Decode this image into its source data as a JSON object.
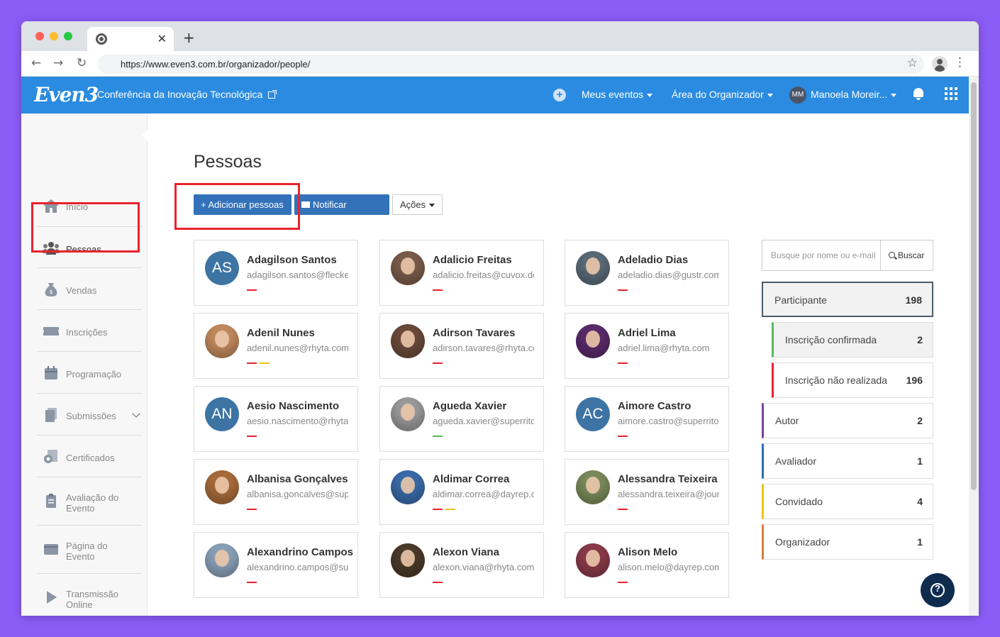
{
  "browser": {
    "url": "https://www.even3.com.br/organizador/people/"
  },
  "header": {
    "logo": "Even3",
    "event_title": "Conferência da Inovação Tecnológica",
    "menu_my_events": "Meus eventos",
    "menu_organizer": "Área do Organizador",
    "user_initials": "MM",
    "user_name": "Manoela Moreir..."
  },
  "sidebar": {
    "items": [
      {
        "label": "Início"
      },
      {
        "label": "Pessoas"
      },
      {
        "label": "Vendas"
      },
      {
        "label": "Inscrições"
      },
      {
        "label": "Programação"
      },
      {
        "label": "Submissões"
      },
      {
        "label": "Certificados"
      },
      {
        "label": "Avaliação do Evento"
      },
      {
        "label": "Página do Evento"
      },
      {
        "label": "Transmissão Online"
      }
    ]
  },
  "main": {
    "title": "Pessoas",
    "add_button": "+ Adicionar pessoas",
    "notify_button": "Notificar pessoas",
    "actions_button": "Ações"
  },
  "people": [
    {
      "initials": "AS",
      "name": "Adagilson Santos",
      "email": "adagilson.santos@fleckens.hu"
    },
    {
      "name": "Adalicio Freitas",
      "email": "adalicio.freitas@cuvox.de"
    },
    {
      "name": "Adeladio Dias",
      "email": "adeladio.dias@gustr.com"
    },
    {
      "name": "Adenil Nunes",
      "email": "adenil.nunes@rhyta.com"
    },
    {
      "name": "Adirson Tavares",
      "email": "adirson.tavares@rhyta.com"
    },
    {
      "name": "Adriel Lima",
      "email": "adriel.lima@rhyta.com"
    },
    {
      "initials": "AN",
      "name": "Aesio Nascimento",
      "email": "aesio.nascimento@rhyta.com"
    },
    {
      "name": "Agueda Xavier",
      "email": "agueda.xavier@superrito.com"
    },
    {
      "initials": "AC",
      "name": "Aimore Castro",
      "email": "aimore.castro@superrito.com"
    },
    {
      "name": "Albanisa Gonçalves",
      "email": "albanisa.goncalves@superrito.com"
    },
    {
      "name": "Aldimar Correa",
      "email": "aldimar.correa@dayrep.com"
    },
    {
      "name": "Alessandra Teixeira",
      "email": "alessandra.teixeira@jourrapide.com"
    },
    {
      "name": "Alexandrino Campos",
      "email": "alexandrino.campos@superrito.com"
    },
    {
      "name": "Alexon Viana",
      "email": "alexon.viana@rhyta.com"
    },
    {
      "name": "Alison Melo",
      "email": "alison.melo@dayrep.com"
    }
  ],
  "tag_colors": {
    "red": "#e8232d",
    "yellow": "#f0c419",
    "green": "#5cb85c"
  },
  "search": {
    "placeholder": "Busque por nome ou e-mail",
    "button": "Buscar"
  },
  "filters": [
    {
      "label": "Participante",
      "count": "198",
      "color": "#4a5a6a"
    },
    {
      "label": "Inscrição confirmada",
      "count": "2",
      "color": "#5cb85c"
    },
    {
      "label": "Inscrição não realizada",
      "count": "196",
      "color": "#e8232d"
    },
    {
      "label": "Autor",
      "count": "2",
      "color": "#7b3fa0"
    },
    {
      "label": "Avaliador",
      "count": "1",
      "color": "#2a6cb8"
    },
    {
      "label": "Convidado",
      "count": "4",
      "color": "#f0c419"
    },
    {
      "label": "Organizador",
      "count": "1",
      "color": "#e07b39"
    }
  ],
  "help": {
    "label": "?"
  }
}
